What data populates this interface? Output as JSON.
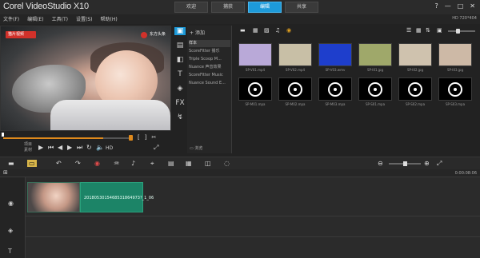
{
  "app": {
    "title": "Corel VideoStudio X10"
  },
  "tabs": [
    {
      "label": "欢迎",
      "active": false
    },
    {
      "label": "捕获",
      "active": false
    },
    {
      "label": "编辑",
      "active": true
    },
    {
      "label": "共享",
      "active": false
    }
  ],
  "window_buttons": [
    "?",
    "—",
    "□",
    "✕"
  ],
  "menu": [
    "文件(F)",
    "编辑(E)",
    "工具(T)",
    "设置(S)",
    "帮助(H)"
  ],
  "status": {
    "resolution": "HD 720*404"
  },
  "preview": {
    "watermark_left": "猫片视频",
    "watermark_right": "东方头条",
    "progress": 0.78,
    "project_label": "项目",
    "clip_label": "素材"
  },
  "library": {
    "add_label": "添加",
    "browse_label": "浏览",
    "items": [
      "样本",
      "ScoreFitter 播乐",
      "Triple Scoop M...",
      "Nuance 声音效果",
      "ScoreFitter Music",
      "Nuance Sound E..."
    ]
  },
  "media": {
    "thumbnails": [
      {
        "caption": "SP-V01.mp4",
        "type": "video",
        "color": "#b9a9d8"
      },
      {
        "caption": "SP-V02.mp4",
        "type": "video",
        "color": "#c8bfa6"
      },
      {
        "caption": "SP-V03.wmv",
        "type": "video",
        "color": "#1e3ecc"
      },
      {
        "caption": "SP-I01.jpg",
        "type": "image",
        "color": "#9fa86a"
      },
      {
        "caption": "SP-I02.jpg",
        "type": "image",
        "color": "#cfc2ae"
      },
      {
        "caption": "SP-I03.jpg",
        "type": "image",
        "color": "#cdb9a6"
      },
      {
        "caption": "SP-M01.mpa",
        "type": "audio",
        "color": "#000000"
      },
      {
        "caption": "SP-M02.mpa",
        "type": "audio",
        "color": "#000000"
      },
      {
        "caption": "SP-M03.mpa",
        "type": "audio",
        "color": "#000000"
      },
      {
        "caption": "SP-S01.mpa",
        "type": "audio",
        "color": "#000000"
      },
      {
        "caption": "SP-S02.mpa",
        "type": "audio",
        "color": "#000000"
      },
      {
        "caption": "SP-S03.mpa",
        "type": "audio",
        "color": "#000000"
      }
    ]
  },
  "timeline": {
    "timecode": "0:00:08:06",
    "clip_name": "2018053015468531864973?_1_06"
  }
}
